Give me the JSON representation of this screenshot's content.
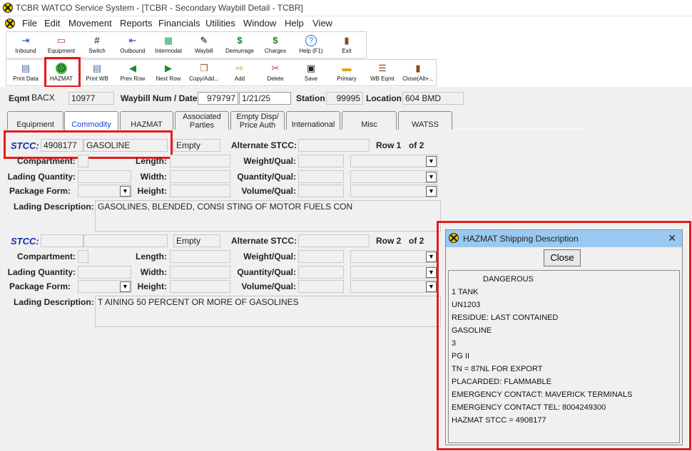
{
  "window": {
    "title": "TCBR WATCO Service System - [TCBR - Secondary Waybill Detail - TCBR]"
  },
  "menu": [
    "File",
    "Edit",
    "Movement",
    "Reports",
    "Financials",
    "Utilities",
    "Window",
    "Help",
    "View"
  ],
  "toolbar1": [
    {
      "label": "Inbound",
      "icon": "inbound-icon",
      "glyph": "⇥"
    },
    {
      "label": "Equipment",
      "icon": "railcar-icon",
      "glyph": "▭"
    },
    {
      "label": "Switch",
      "icon": "switch-track-icon",
      "glyph": "#"
    },
    {
      "label": "Outbound",
      "icon": "outbound-icon",
      "glyph": "⇤"
    },
    {
      "label": "Intermodal",
      "icon": "intermodal-icon",
      "glyph": "▦"
    },
    {
      "label": "Waybill",
      "icon": "waybill-icon",
      "glyph": "✎"
    },
    {
      "label": "Demurrage",
      "icon": "dollar-icon",
      "glyph": "$"
    },
    {
      "label": "Charges",
      "icon": "money-bag-icon",
      "glyph": "$"
    },
    {
      "label": "Help (F1)",
      "icon": "help-icon",
      "glyph": "?"
    },
    {
      "label": "Exit",
      "icon": "exit-door-icon",
      "glyph": "▮"
    }
  ],
  "toolbar2": [
    {
      "label": "Print Data",
      "icon": "printer-icon",
      "glyph": "▤"
    },
    {
      "label": "HAZMAT",
      "icon": "hazmat-face-icon",
      "glyph": "☹"
    },
    {
      "label": "Print WB",
      "icon": "printer-icon",
      "glyph": "▤"
    },
    {
      "label": "Prev Row",
      "icon": "arrow-left-icon",
      "glyph": "◀"
    },
    {
      "label": "Next Row",
      "icon": "arrow-right-icon",
      "glyph": "▶"
    },
    {
      "label": "Copy/Add...",
      "icon": "copy-icon",
      "glyph": "❐"
    },
    {
      "label": "Add",
      "icon": "add-icon",
      "glyph": "⇨"
    },
    {
      "label": "Delete",
      "icon": "delete-icon",
      "glyph": "✂"
    },
    {
      "label": "Save",
      "icon": "save-disk-icon",
      "glyph": "▣"
    },
    {
      "label": "Primary",
      "icon": "folder-icon",
      "glyph": "▬"
    },
    {
      "label": "WB Eqmt",
      "icon": "list-icon",
      "glyph": "☰"
    },
    {
      "label": "Close(Alt+...",
      "icon": "close-door-icon",
      "glyph": "▮"
    }
  ],
  "header": {
    "eqmt_label": "Eqmt",
    "eqmt_init": "BACX",
    "eqmt_num": "10977",
    "waybill_label": "Waybill Num / Date",
    "waybill_num": "979797",
    "waybill_date": "1/21/25",
    "station_label": "Station",
    "station_num": "99995",
    "location_label": "Location",
    "location_val": "604 BMD"
  },
  "tabs": [
    {
      "label": "Equipment",
      "active": false
    },
    {
      "label": "Commodity",
      "active": true
    },
    {
      "label": "HAZMAT",
      "active": false
    },
    {
      "label": "Associated Parties",
      "active": false
    },
    {
      "label": "Empty Disp/ Price Auth",
      "active": false
    },
    {
      "label": "International",
      "active": false
    },
    {
      "label": "Misc",
      "active": false
    },
    {
      "label": "WATSS",
      "active": false
    }
  ],
  "labels": {
    "stcc": "STCC:",
    "empty": "Empty",
    "alt_stcc": "Alternate STCC:",
    "compartment": "Compartment:",
    "length": "Length:",
    "weight_qual": "Weight/Qual:",
    "lading_qty": "Lading Quantity:",
    "width": "Width:",
    "quantity_qual": "Quantity/Qual:",
    "package_form": "Package Form:",
    "height": "Height:",
    "volume_qual": "Volume/Qual:",
    "lading_desc": "Lading Description:",
    "of": "of 2"
  },
  "rows": [
    {
      "row_label": "Row 1",
      "stcc_code": "4908177",
      "stcc_desc": "GASOLINE",
      "description": "GASOLINES, BLENDED, CONSI STING OF MOTOR FUELS CON"
    },
    {
      "row_label": "Row 2",
      "stcc_code": "",
      "stcc_desc": "",
      "description": "T AINING 50 PERCENT OR MORE OF GASOLINES"
    }
  ],
  "hazmat_dialog": {
    "title": "HAZMAT Shipping Description",
    "close_label": "Close",
    "lines": [
      "DANGEROUS",
      "1 TANK",
      "UN1203",
      "RESIDUE: LAST CONTAINED",
      "GASOLINE",
      "3",
      "PG II",
      "TN = 87NL FOR EXPORT",
      "PLACARDED: FLAMMABLE",
      "EMERGENCY CONTACT: MAVERICK TERMINALS",
      "EMERGENCY CONTACT TEL: 8004249300",
      "HAZMAT STCC = 4908177"
    ]
  },
  "colors": {
    "highlight": "#e31c1c",
    "dialog_header": "#99c9f0",
    "stcc_label": "#1a2fa0",
    "active_tab": "#1a3fd8"
  }
}
